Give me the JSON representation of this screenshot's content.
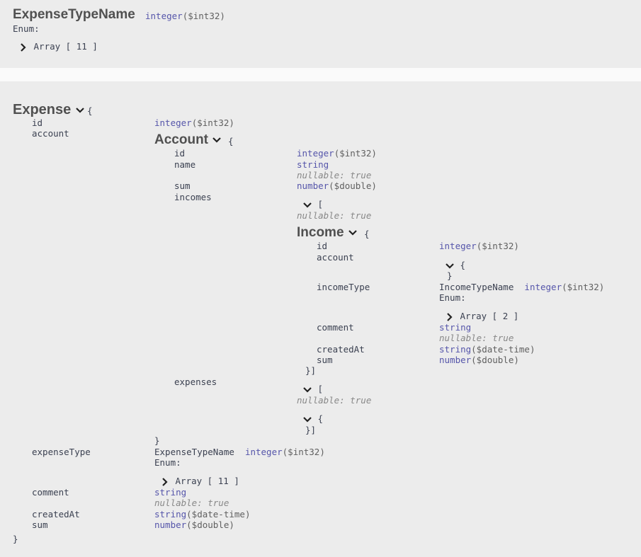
{
  "enum_model": {
    "name": "ExpenseTypeName",
    "type": "integer",
    "format": "($int32)",
    "enum_label": "Enum:",
    "array_toggle": "Array [ 11 ]"
  },
  "expense": {
    "name": "Expense",
    "open_brace": "{",
    "close_brace": "}",
    "fields": {
      "id": {
        "label": "id",
        "type": "integer",
        "format": "($int32)"
      },
      "account": {
        "label": "account"
      },
      "expenseType": {
        "label": "expenseType",
        "ref_name": "ExpenseTypeName",
        "type": "integer",
        "format": "($int32)",
        "enum_label": "Enum:",
        "array_toggle": "Array [ 11 ]"
      },
      "comment": {
        "label": "comment",
        "type": "string",
        "nullable": "nullable: true"
      },
      "createdAt": {
        "label": "createdAt",
        "type": "string",
        "format": "($date-time)"
      },
      "sum": {
        "label": "sum",
        "type": "number",
        "format": "($double)"
      }
    }
  },
  "account": {
    "name": "Account",
    "open_brace": "{",
    "close_brace": "}",
    "fields": {
      "id": {
        "label": "id",
        "type": "integer",
        "format": "($int32)"
      },
      "name": {
        "label": "name",
        "type": "string",
        "nullable": "nullable: true"
      },
      "sum": {
        "label": "sum",
        "type": "number",
        "format": "($double)"
      },
      "incomes": {
        "label": "incomes",
        "open_bracket": "[",
        "nullable": "nullable: true",
        "close": "}]"
      },
      "expenses": {
        "label": "expenses",
        "open_bracket": "[",
        "nullable": "nullable: true",
        "open_brace": "{",
        "close": "}]"
      }
    }
  },
  "income": {
    "name": "Income",
    "open_brace": "{",
    "fields": {
      "id": {
        "label": "id",
        "type": "integer",
        "format": "($int32)"
      },
      "account": {
        "label": "account",
        "open_brace": "{",
        "close_brace": "}"
      },
      "incomeType": {
        "label": "incomeType",
        "ref_name": "IncomeTypeName",
        "type": "integer",
        "format": "($int32)",
        "enum_label": "Enum:",
        "array_toggle": "Array [ 2 ]"
      },
      "comment": {
        "label": "comment",
        "type": "string",
        "nullable": "nullable: true"
      },
      "createdAt": {
        "label": "createdAt",
        "type": "string",
        "format": "($date-time)"
      },
      "sum": {
        "label": "sum",
        "type": "number",
        "format": "($double)"
      }
    }
  },
  "colors": {
    "type": "#55a",
    "text": "#3b4151",
    "band": "#ececec"
  },
  "icons": {
    "collapse": "chevron-down-icon",
    "expand": "chevron-right-icon"
  }
}
